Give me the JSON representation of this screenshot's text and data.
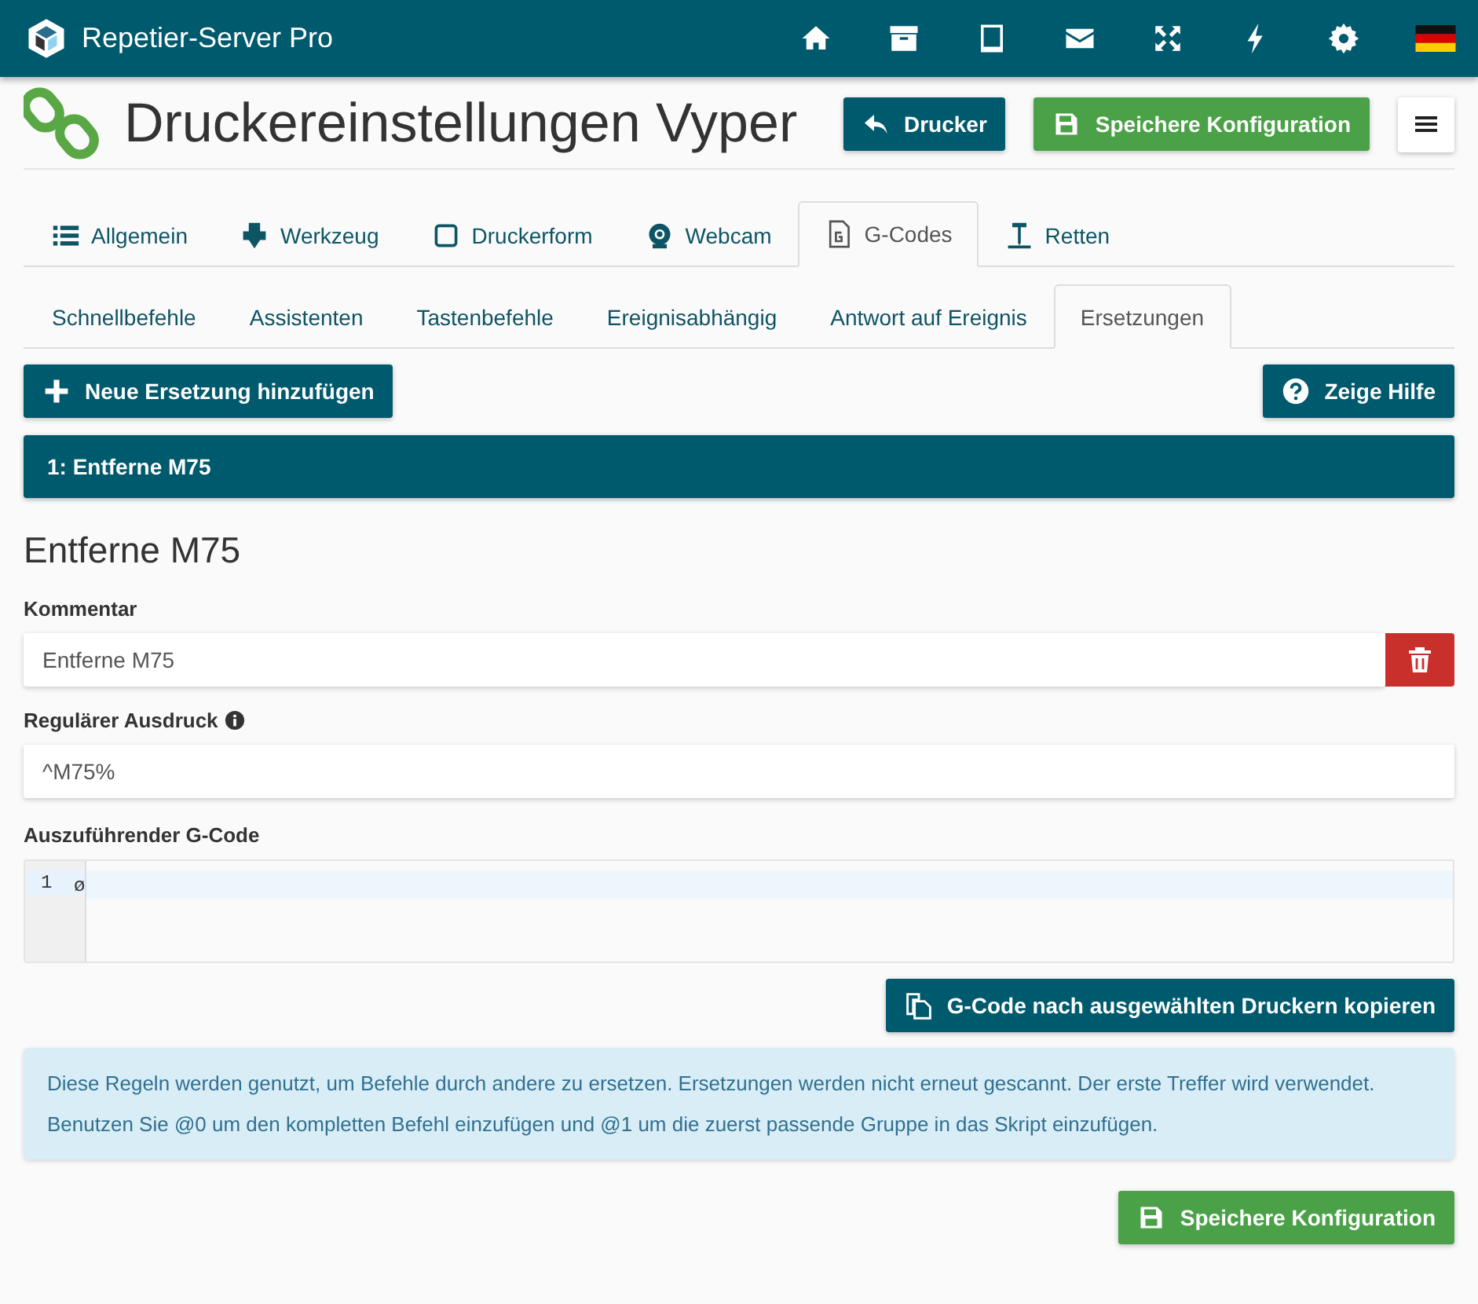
{
  "app": {
    "title": "Repetier-Server Pro"
  },
  "page": {
    "title": "Druckereinstellungen Vyper",
    "back_button": "Drucker",
    "save_button": "Speichere Konfiguration"
  },
  "tabs": [
    {
      "label": "Allgemein",
      "selected": false
    },
    {
      "label": "Werkzeug",
      "selected": false
    },
    {
      "label": "Druckerform",
      "selected": false
    },
    {
      "label": "Webcam",
      "selected": false
    },
    {
      "label": "G-Codes",
      "selected": true
    },
    {
      "label": "Retten",
      "selected": false
    }
  ],
  "subtabs": [
    {
      "label": "Schnellbefehle",
      "selected": false
    },
    {
      "label": "Assistenten",
      "selected": false
    },
    {
      "label": "Tastenbefehle",
      "selected": false
    },
    {
      "label": "Ereignisabhängig",
      "selected": false
    },
    {
      "label": "Antwort auf Ereignis",
      "selected": false
    },
    {
      "label": "Ersetzungen",
      "selected": true
    }
  ],
  "add_button": "Neue Ersetzung hinzufügen",
  "help_button": "Zeige Hilfe",
  "replacements": [
    {
      "label": "1: Entferne M75"
    }
  ],
  "editor": {
    "title": "Entferne M75",
    "comment_label": "Kommentar",
    "comment_value": "Entferne M75",
    "regex_label": "Regulärer Ausdruck",
    "regex_value": "^M75%",
    "gcode_label": "Auszuführender G-Code",
    "line_number": "1",
    "code": "ø"
  },
  "copy_button": "G-Code nach ausgewählten Druckern kopieren",
  "info": [
    "Diese Regeln werden genutzt, um Befehle durch andere zu ersetzen. Ersetzungen werden nicht erneut gescannt. Der erste Treffer wird verwendet.",
    "Benutzen Sie @0 um den kompletten Befehl einzufügen und @1 um die zuerst passende Gruppe in das Skript einzufügen."
  ],
  "footer_button": "Speichere Konfiguration"
}
